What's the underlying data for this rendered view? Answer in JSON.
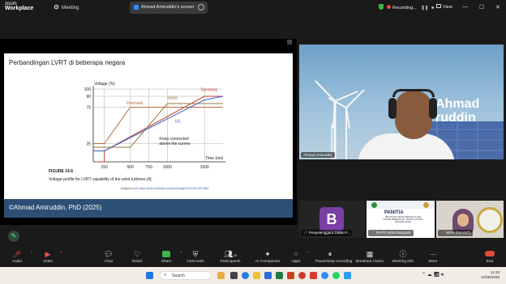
{
  "titlebar": {
    "brand_top": "zoom",
    "brand_bottom": "Workplace",
    "meeting_label": "Meeting",
    "share_label": "Ahmad Amiruddin's screen",
    "recording_label": "Recording...",
    "view_label": "View"
  },
  "slide": {
    "title": "Perbandingan LVRT di beberapa negara",
    "figure_label": "FIGURE 14.6",
    "figure_caption": "Voltage profile for LVRT capability of the wind turbines [4].",
    "adapted_prefix": "Adapted from",
    "adapted_url": "https://www.hindawi.com/journals/jp/2013/257487/#B2",
    "watermark": "©Ahmad Amiruddin, PhD (2025)"
  },
  "chart_data": {
    "type": "line",
    "title": "",
    "xlabel": "Time (ms)",
    "ylabel": "Voltage (%)",
    "xticks": [
      150,
      500,
      750,
      1000,
      1500
    ],
    "yticks": [
      100,
      90,
      75,
      25
    ],
    "xlim": [
      0,
      1750
    ],
    "ylim": [
      0,
      100
    ],
    "annotation": "Keep connected above the curves",
    "series": [
      {
        "name": "Germany",
        "color": "#c0392b",
        "points": [
          [
            0,
            0
          ],
          [
            150,
            0
          ],
          [
            150,
            15
          ],
          [
            1500,
            90
          ],
          [
            1750,
            90
          ]
        ]
      },
      {
        "name": "Spain",
        "color": "#9a7b3a",
        "points": [
          [
            0,
            20
          ],
          [
            500,
            20
          ],
          [
            1000,
            80
          ],
          [
            1750,
            80
          ]
        ]
      },
      {
        "name": "Denmark",
        "color": "#b86b3a",
        "points": [
          [
            0,
            25
          ],
          [
            150,
            25
          ],
          [
            500,
            75
          ],
          [
            1750,
            75
          ]
        ]
      },
      {
        "name": "US",
        "color": "#3b5ec7",
        "points": [
          [
            0,
            15
          ],
          [
            150,
            15
          ],
          [
            1500,
            85
          ],
          [
            1750,
            90
          ]
        ]
      }
    ]
  },
  "participants": {
    "main_name": "Ahmad Amiruddin",
    "main_bg_text_1": "Ahmad",
    "main_bg_text_2": "ruddin",
    "tiles": [
      {
        "name": "Penyelenggara Diklat P...",
        "avatar_letter": "B",
        "avatar_color": "#7a3fa5"
      },
      {
        "name": "PLPTI-Ndra Rasyanti",
        "slide_title": "PANITIA",
        "slide_subtitle": "PELATIHAN TEKNIS PENGELOLAAN SISTEM PEMBANGKIT TENAGA LISTRIK JENJANG MUDA"
      },
      {
        "name": "NINA (NKANT)"
      }
    ]
  },
  "toolbar": {
    "audio": "Audio",
    "video": "Video",
    "chat": "Chat",
    "react": "React",
    "share": "Share",
    "host_tools": "Host tools",
    "participants": "Participants",
    "participants_count": "18",
    "ai_companion": "AI Companion",
    "apps": "Apps",
    "pause_recording": "Pause/stop recording",
    "breakout_rooms": "Breakout rooms",
    "meeting_info": "Meeting info",
    "more": "More",
    "end": "End"
  },
  "taskbar": {
    "search_placeholder": "Search",
    "time": "11:33",
    "date": "12/06/2025"
  }
}
